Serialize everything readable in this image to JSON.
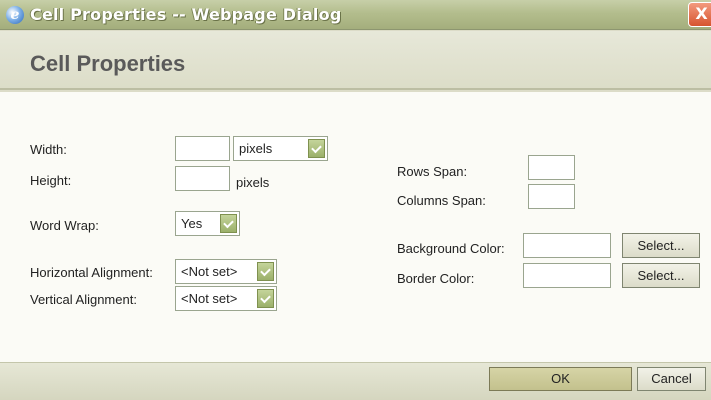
{
  "window": {
    "title": "Cell Properties -- Webpage Dialog",
    "close_label": "X"
  },
  "dialog": {
    "heading": "Cell Properties"
  },
  "form": {
    "width_label": "Width:",
    "width_value": "",
    "width_unit": "pixels",
    "height_label": "Height:",
    "height_value": "",
    "height_unit": "pixels",
    "word_wrap_label": "Word Wrap:",
    "word_wrap_value": "Yes",
    "h_align_label": "Horizontal Alignment:",
    "h_align_value": "<Not set>",
    "v_align_label": "Vertical Alignment:",
    "v_align_value": "<Not set>",
    "rows_span_label": "Rows Span:",
    "rows_span_value": "",
    "cols_span_label": "Columns Span:",
    "cols_span_value": "",
    "bg_color_label": "Background Color:",
    "bg_color_value": "",
    "border_color_label": "Border Color:",
    "border_color_value": "",
    "select_label": "Select..."
  },
  "footer": {
    "ok_label": "OK",
    "cancel_label": "Cancel"
  },
  "icons": {
    "app": "ie-icon",
    "close": "close-icon",
    "dropdown": "chevron-down-icon"
  },
  "colors": {
    "titlebar": "#b3bd8d",
    "close": "#d6542f",
    "accent": "#9bb06a"
  }
}
